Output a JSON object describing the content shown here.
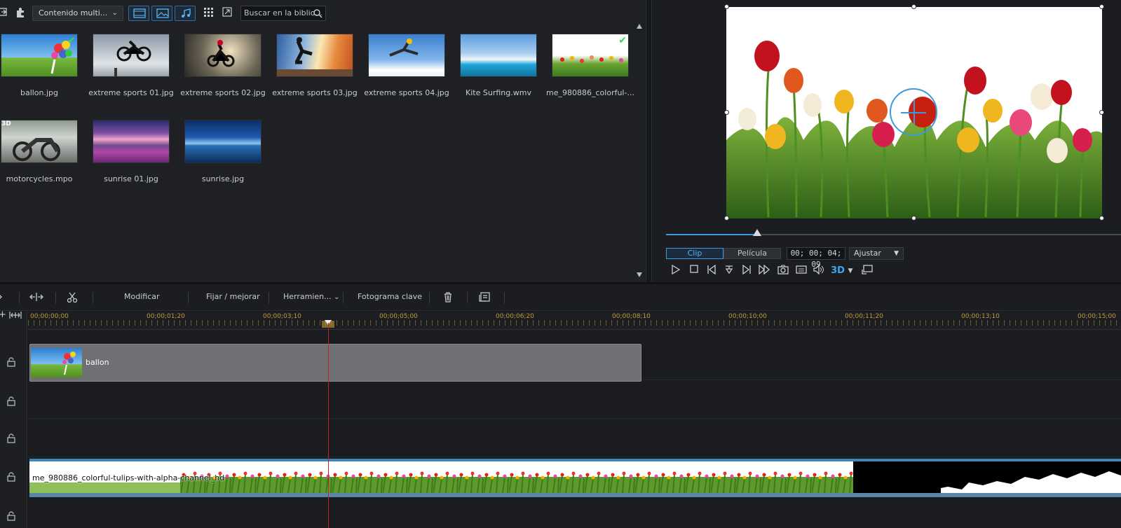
{
  "library": {
    "content_dropdown": "Contenido multi...",
    "search_placeholder": "Buscar en la biblio...",
    "items": [
      {
        "label": "ballon.jpg",
        "checked": true
      },
      {
        "label": "extreme sports 01.jpg"
      },
      {
        "label": "extreme sports 02.jpg"
      },
      {
        "label": "extreme sports 03.jpg"
      },
      {
        "label": "extreme sports 04.jpg"
      },
      {
        "label": "Kite Surfing.wmv"
      },
      {
        "label": "me_980886_colorful-...",
        "checked": true
      },
      {
        "label": "motorcycles.mpo",
        "badge": "3D"
      },
      {
        "label": "sunrise 01.jpg"
      },
      {
        "label": "sunrise.jpg"
      }
    ]
  },
  "preview": {
    "clip_label": "Clip",
    "movie_label": "Película",
    "timecode": "00; 00; 04; 09",
    "fit_label": "Ajustar",
    "scrub_progress": 0.2,
    "three_d_label": "3D"
  },
  "edit_toolbar": {
    "modify": "Modificar",
    "fix_enhance": "Fijar / mejorar",
    "tools": "Herramien...",
    "keyframe": "Fotograma clave"
  },
  "timeline": {
    "ruler_labels": [
      "00;00;00;00",
      "00;00;01;20",
      "00;00;03;10",
      "00;00;05;00",
      "00;00;06;20",
      "00;00;08;10",
      "00;00;10;00",
      "00;00;11;20",
      "00;00;13;10",
      "00;00;15;00"
    ],
    "clip_ballon": "ballon",
    "clip_tulips": "me_980886_colorful-tulips-with-alpha-channel_hd"
  },
  "colors": {
    "accent": "#3a9ae0",
    "check": "#3fd451",
    "ruler": "#c59d3a",
    "playhead": "#c0242a"
  }
}
